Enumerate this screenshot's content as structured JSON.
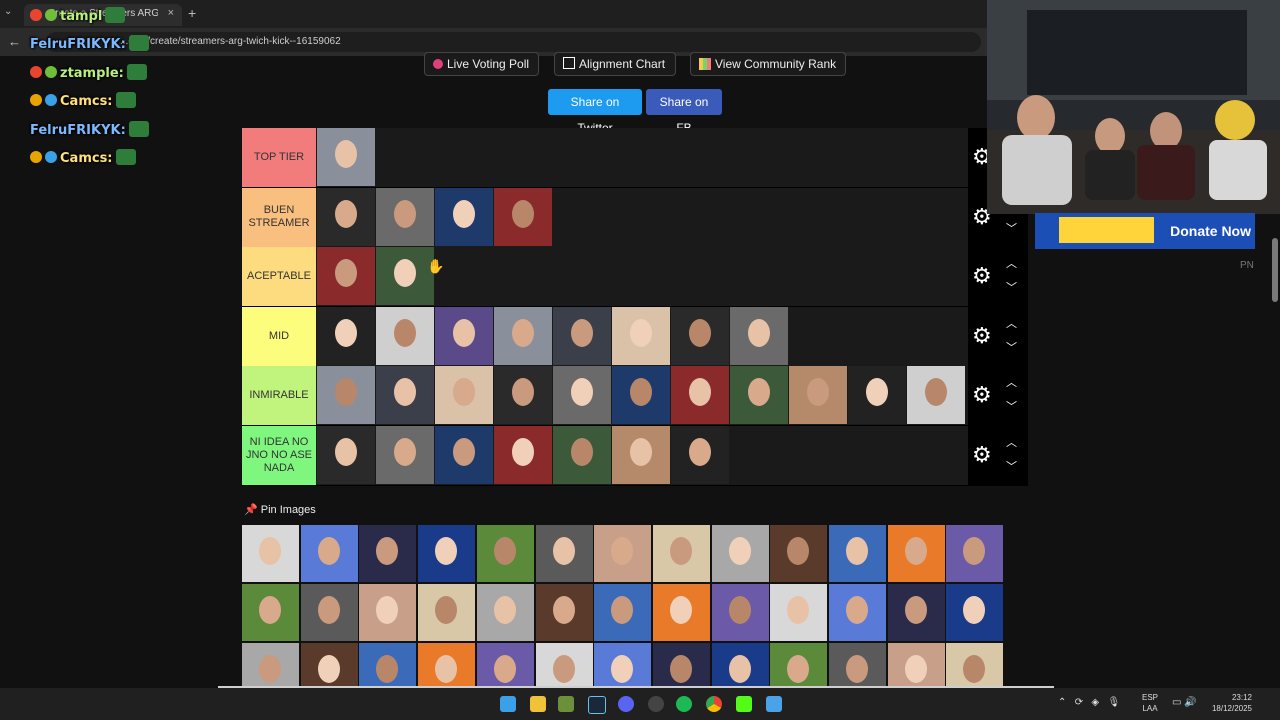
{
  "browser": {
    "tab_title": "Create a Streamers ARG twich...",
    "tab_close": "×",
    "new_tab": "+",
    "url": "...com/create/streamers-arg-twich-kick--16159062"
  },
  "chat": [
    {
      "user": "tampl",
      "message": ""
    },
    {
      "user": "FelruFRIKYK:",
      "message": ""
    },
    {
      "user": "ztample:",
      "message": ""
    },
    {
      "user": "Camcs:",
      "message": ""
    },
    {
      "user": "FelruFRIKYK:",
      "message": ""
    },
    {
      "user": "Camcs:",
      "message": ""
    }
  ],
  "top_buttons": [
    {
      "label": "Live Voting Poll"
    },
    {
      "label": "Alignment Chart"
    },
    {
      "label": "View Community Rank"
    }
  ],
  "share": {
    "twitter": "Share on Twitter",
    "fb": "Share on FB"
  },
  "tiers": [
    {
      "label": "TOP TIER",
      "color": "#f27b7b",
      "count": 1
    },
    {
      "label": "BUEN STREAMER",
      "color": "#f9bf7f",
      "count": 4
    },
    {
      "label": "ACEPTABLE",
      "color": "#fcdc7f",
      "count": 2
    },
    {
      "label": "MID",
      "color": "#fcfc7d",
      "count": 8
    },
    {
      "label": "INMIRABLE",
      "color": "#c1f47c",
      "count": 11
    },
    {
      "label": "NI IDEA NO JNO NO ASE NADA",
      "color": "#7ff77f",
      "count": 7
    }
  ],
  "controls": {
    "gear": "⚙",
    "up": "︿",
    "down": "﹀"
  },
  "donate": "Donate Now",
  "side_label": "PN",
  "pin_label": "Pin Images",
  "taskbar": {
    "lang_top": "ESP",
    "lang_bottom": "LAA",
    "time": "23:12",
    "date": "18/12/2025"
  }
}
